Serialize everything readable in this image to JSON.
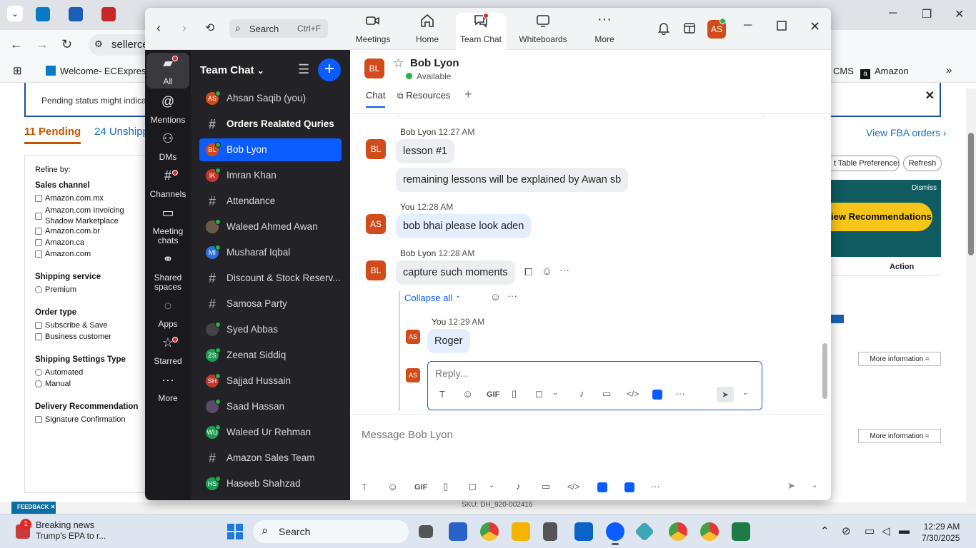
{
  "browser": {
    "address": "sellerce",
    "bookmarks": [
      {
        "label": "Welcome- ECExpres..."
      },
      {
        "label": "CMS"
      },
      {
        "label": "Amazon"
      }
    ]
  },
  "seller_page": {
    "alert_text": "Pending status might indicate a",
    "tabs": {
      "pending": "11 Pending",
      "unshipped": "24 Unshippe"
    },
    "refine_title": "Refine by:",
    "sales_channel": {
      "title": "Sales channel",
      "options": [
        "Amazon.com.mx",
        "Amazon.com Invoicing Shadow Marketplace",
        "Amazon.com.br",
        "Amazon.ca",
        "Amazon.com"
      ]
    },
    "shipping_service": {
      "title": "Shipping service",
      "options": [
        "Premium"
      ]
    },
    "order_type": {
      "title": "Order type",
      "options": [
        "Subscribe & Save",
        "Business customer"
      ]
    },
    "shipping_settings": {
      "title": "Shipping Settings Type",
      "options": [
        "Automated",
        "Manual"
      ]
    },
    "delivery_reco": {
      "title": "Delivery Recommendation",
      "options": [
        "Signature Confirmation"
      ]
    },
    "view_fba": "View FBA orders ›",
    "table_prefs": "t Table Preferences",
    "refresh": "Refresh",
    "dismiss": "Dismiss",
    "view_reco": "iew Recommendations",
    "action_header": "Action",
    "more_info": "More information ≈",
    "sku": "SKU: DH_920-002416",
    "feedback": "FEEDBACK ✕"
  },
  "zoom": {
    "search_placeholder": "Search",
    "search_shortcut": "Ctrl+F",
    "nav": [
      {
        "label": "Meetings"
      },
      {
        "label": "Home"
      },
      {
        "label": "Team Chat"
      },
      {
        "label": "Whiteboards"
      },
      {
        "label": "More"
      }
    ],
    "profile_initials": "AS",
    "left_nav": [
      {
        "label": "All"
      },
      {
        "label": "Mentions"
      },
      {
        "label": "DMs"
      },
      {
        "label": "Channels"
      },
      {
        "label": "Meeting chats"
      },
      {
        "label": "Shared spaces"
      },
      {
        "label": "Apps"
      },
      {
        "label": "Starred"
      },
      {
        "label": "More"
      }
    ],
    "list_title": "Team Chat",
    "chats": [
      {
        "name": "Ahsan Saqib (you)",
        "initials": "AS",
        "color": "#d14b1b"
      },
      {
        "name": "Orders Realated Quries",
        "initials": "#",
        "color": ""
      },
      {
        "name": "Bob Lyon",
        "initials": "BL",
        "color": "#d14b1b"
      },
      {
        "name": "Imran Khan",
        "initials": "IK",
        "color": "#c0392b"
      },
      {
        "name": "Attendance",
        "initials": "#",
        "color": ""
      },
      {
        "name": "Waleed Ahmed Awan",
        "initials": "",
        "color": "#6b5a4a"
      },
      {
        "name": "Musharaf Iqbal",
        "initials": "MI",
        "color": "#2f6fd6"
      },
      {
        "name": "Discount & Stock Reserv...",
        "initials": "#",
        "color": ""
      },
      {
        "name": "Samosa Party",
        "initials": "#",
        "color": ""
      },
      {
        "name": "Syed Abbas",
        "initials": "",
        "color": "#444"
      },
      {
        "name": "Zeenat Siddiq",
        "initials": "ZS",
        "color": "#1f9d55"
      },
      {
        "name": "Sajjad Hussain",
        "initials": "SH",
        "color": "#c0392b"
      },
      {
        "name": "Saad Hassan",
        "initials": "",
        "color": "#5a4a6b"
      },
      {
        "name": "Waleed Ur Rehman",
        "initials": "WU",
        "color": "#1f9d55"
      },
      {
        "name": "Amazon Sales Team",
        "initials": "#",
        "color": ""
      },
      {
        "name": "Haseeb Shahzad",
        "initials": "HS",
        "color": "#1f9d55"
      }
    ],
    "header": {
      "initials": "BL",
      "name": "Bob Lyon",
      "status": "Available",
      "tab_chat": "Chat",
      "tab_resources": "Resources"
    },
    "messages": [
      {
        "author": "Bob Lyon",
        "time": "12:27 AM",
        "initials": "BL",
        "texts": [
          "lesson #1",
          "remaining lessons will be explained by Awan sb"
        ]
      },
      {
        "author": "You",
        "time": "12:28 AM",
        "initials": "AS",
        "texts": [
          "bob bhai please look aden"
        ]
      },
      {
        "author": "Bob Lyon",
        "time": "12:28 AM",
        "initials": "BL",
        "texts": [
          "capture such moments"
        ]
      }
    ],
    "collapse_label": "Collapse all",
    "thread_reply": {
      "author": "You",
      "time": "12:29 AM",
      "initials": "AS",
      "text": "Roger"
    },
    "reply_placeholder": "Reply...",
    "composer_placeholder": "Message Bob Lyon",
    "gif_label": "GIF"
  },
  "taskbar": {
    "news_title": "Breaking news",
    "news_sub": "Trump's EPA to r...",
    "news_count": "1",
    "search_label": "Search",
    "time": "12:29 AM",
    "date": "7/30/2025"
  }
}
